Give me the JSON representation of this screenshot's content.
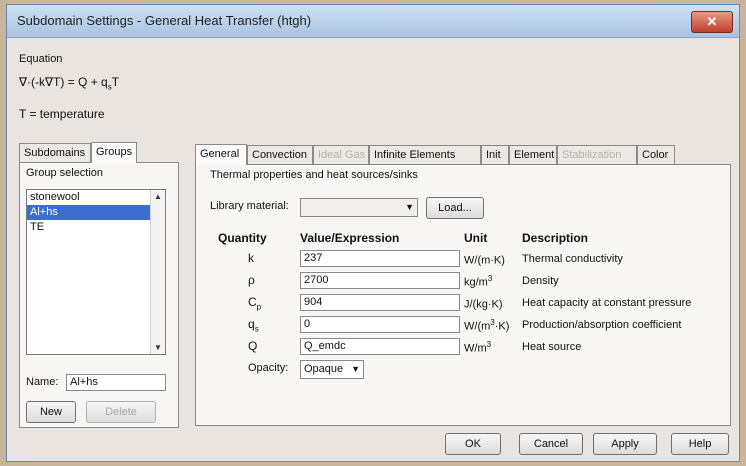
{
  "window": {
    "title": "Subdomain Settings - General Heat Transfer (htgh)",
    "close": "✕"
  },
  "equation": {
    "label": "Equation",
    "line1": "∇·(-k∇T) = Q + q",
    "line1_sub": "s",
    "line1_end": "T",
    "line2": "T = temperature"
  },
  "left_tabs": [
    "Subdomains",
    "Groups"
  ],
  "group_selection": {
    "label": "Group selection",
    "items": [
      "stonewool",
      "Al+hs",
      "TE"
    ],
    "selected": "Al+hs",
    "name_label": "Name:",
    "name_value": "Al+hs",
    "new_label": "New",
    "delete_label": "Delete"
  },
  "right_tabs": [
    {
      "label": "General",
      "state": "active"
    },
    {
      "label": "Convection",
      "state": "normal"
    },
    {
      "label": "Ideal Gas",
      "state": "disabled"
    },
    {
      "label": "Infinite Elements",
      "state": "normal"
    },
    {
      "label": "Init",
      "state": "normal"
    },
    {
      "label": "Element",
      "state": "normal"
    },
    {
      "label": "Stabilization",
      "state": "disabled"
    },
    {
      "label": "Color",
      "state": "normal"
    }
  ],
  "general": {
    "section_title": "Thermal properties and heat sources/sinks",
    "library_label": "Library material:",
    "library_value": "",
    "load_label": "Load...",
    "headers": {
      "quantity": "Quantity",
      "value": "Value/Expression",
      "unit": "Unit",
      "description": "Description"
    },
    "rows": [
      {
        "quantity": "k",
        "qsub": "",
        "value": "237",
        "unit": "W/(m·K)",
        "unit_sup": "",
        "unit_end": "",
        "description": "Thermal conductivity"
      },
      {
        "quantity": "ρ",
        "qsub": "",
        "value": "2700",
        "unit": "kg/m",
        "unit_sup": "3",
        "unit_end": "",
        "description": "Density"
      },
      {
        "quantity": "C",
        "qsub": "p",
        "value": "904",
        "unit": "J/(kg·K)",
        "unit_sup": "",
        "unit_end": "",
        "description": "Heat capacity at constant pressure"
      },
      {
        "quantity": "q",
        "qsub": "s",
        "value": "0",
        "unit": "W/(m",
        "unit_sup": "3",
        "unit_end": "·K)",
        "description": "Production/absorption coefficient"
      },
      {
        "quantity": "Q",
        "qsub": "",
        "value": "Q_emdc",
        "unit": "W/m",
        "unit_sup": "3",
        "unit_end": "",
        "description": "Heat source"
      }
    ],
    "opacity_label": "Opacity:",
    "opacity_value": "Opaque"
  },
  "buttons": {
    "ok": "OK",
    "cancel": "Cancel",
    "apply": "Apply",
    "help": "Help"
  }
}
